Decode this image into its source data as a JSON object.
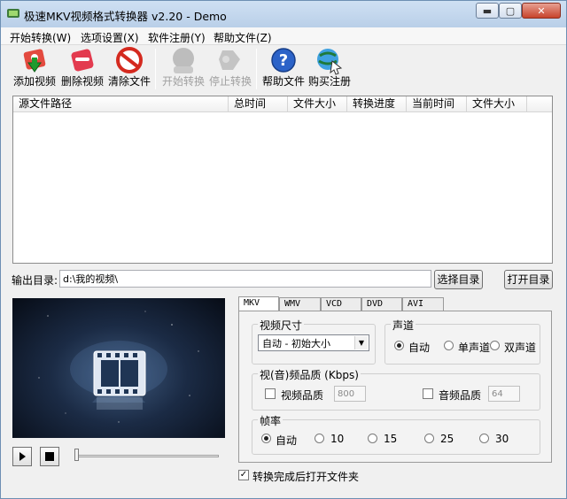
{
  "window": {
    "title": "极速MKV视频格式转换器 v2.20 - Demo"
  },
  "menu": [
    "开始转换(W)",
    "选项设置(X)",
    "软件注册(Y)",
    "帮助文件(Z)"
  ],
  "toolbar": {
    "add": "添加视频",
    "delete": "删除视频",
    "clear": "清除文件",
    "start": "开始转换",
    "stop": "停止转换",
    "help": "帮助文件",
    "buy": "购买注册"
  },
  "columns": [
    "源文件路径",
    "总时间",
    "文件大小",
    "转换进度",
    "当前时间",
    "文件大小"
  ],
  "output": {
    "label": "输出目录:",
    "path": "d:\\我的视频\\",
    "choose": "选择目录",
    "open": "打开目录"
  },
  "tabs": [
    "MKV",
    "WMV",
    "VCD",
    "DVD",
    "AVI"
  ],
  "video_size": {
    "title": "视频尺寸",
    "selected": "自动 - 初始大小"
  },
  "audio_channel": {
    "title": "声道",
    "options": [
      "自动",
      "单声道",
      "双声道"
    ],
    "selected_index": 0
  },
  "quality": {
    "title": "视(音)频品质 (Kbps)",
    "video_label": "视频品质",
    "video_value": "800",
    "audio_label": "音频品质",
    "audio_value": "64"
  },
  "framerate": {
    "title": "帧率",
    "options": [
      "自动",
      "10",
      "15",
      "25",
      "30"
    ],
    "selected_index": 0
  },
  "open_after": {
    "label": "转换完成后打开文件夹",
    "checked": true
  },
  "playback_position": 0
}
